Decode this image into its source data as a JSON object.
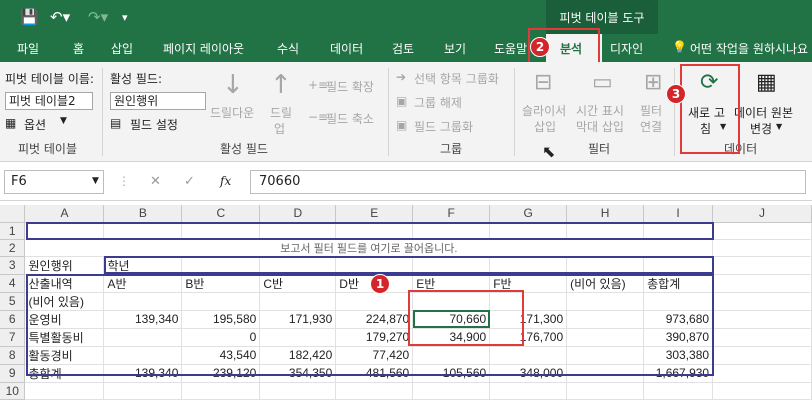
{
  "context_tab": "피벗 테이블 도구",
  "tabs": [
    "파일",
    "홈",
    "삽입",
    "페이지 레이아웃",
    "수식",
    "데이터",
    "검토",
    "보기",
    "도움말",
    "분석",
    "디자인"
  ],
  "tell_me": "어떤 작업을 원하시나요",
  "ribbon": {
    "pivot_name_label": "피벗 테이블 이름:",
    "pivot_name_value": "피벗 테이블2",
    "options_label": "옵션",
    "group_pivot": "피벗 테이블",
    "active_field_label": "활성 필드:",
    "active_field_value": "원인행위",
    "field_settings_label": "필드 설정",
    "drill_down": "드릴다운",
    "drill_up_1": "드릴",
    "drill_up_2": "업",
    "expand_field": "필드 확장",
    "collapse_field": "필드 축소",
    "group_active": "활성 필드",
    "group_selection": "선택 항목 그룹화",
    "ungroup": "그룹 해제",
    "group_field": "필드 그룹화",
    "group_group": "그룹",
    "slicer_1": "슬라이서",
    "slicer_2": "삽입",
    "timeline_1": "시간 표시",
    "timeline_2": "막대 삽입",
    "filter_conn_1": "필터",
    "filter_conn_2": "연결",
    "group_filter": "필터",
    "refresh_1": "새로 고",
    "refresh_2": "침",
    "change_source_1": "데이터 원본",
    "change_source_2": "변경",
    "group_data": "데이터"
  },
  "badges": [
    "1",
    "2",
    "3"
  ],
  "formula": {
    "cell": "F6",
    "value": "70660"
  },
  "columns": [
    "",
    "A",
    "B",
    "C",
    "D",
    "E",
    "F",
    "G",
    "H",
    "I",
    "J"
  ],
  "rows": [
    {
      "n": "1",
      "cells": [
        "",
        "",
        "",
        "",
        "",
        "",
        "",
        "",
        ""
      ]
    },
    {
      "n": "2",
      "cells": [
        "보고서 필터 필드를 여기로 끌어옵니다.",
        "",
        "",
        "",
        "",
        "",
        "",
        "",
        ""
      ]
    },
    {
      "n": "3",
      "cells": [
        "원인행위",
        "학년",
        "",
        "",
        "",
        "",
        "",
        "",
        ""
      ]
    },
    {
      "n": "4",
      "cells": [
        "산출내역",
        "A반",
        "B반",
        "C반",
        "D반",
        "E반",
        "F반",
        "(비어 있음)",
        "총합계"
      ]
    },
    {
      "n": "5",
      "cells": [
        "(비어 있음)",
        "",
        "",
        "",
        "",
        "",
        "",
        "",
        ""
      ]
    },
    {
      "n": "6",
      "cells": [
        "운영비",
        "139,340",
        "195,580",
        "171,930",
        "224,870",
        "70,660",
        "171,300",
        "",
        "973,680"
      ]
    },
    {
      "n": "7",
      "cells": [
        "특별활동비",
        "",
        "0",
        "",
        "179,270",
        "34,900",
        "176,700",
        "",
        "390,870"
      ]
    },
    {
      "n": "8",
      "cells": [
        "활동경비",
        "",
        "43,540",
        "182,420",
        "77,420",
        "",
        "",
        "",
        "303,380"
      ]
    },
    {
      "n": "9",
      "cells": [
        "총합계",
        "139,340",
        "239,120",
        "354,350",
        "481,560",
        "105,560",
        "348,000",
        "",
        "1,667,930"
      ]
    },
    {
      "n": "10",
      "cells": [
        "",
        "",
        "",
        "",
        "",
        "",
        "",
        "",
        ""
      ]
    }
  ]
}
